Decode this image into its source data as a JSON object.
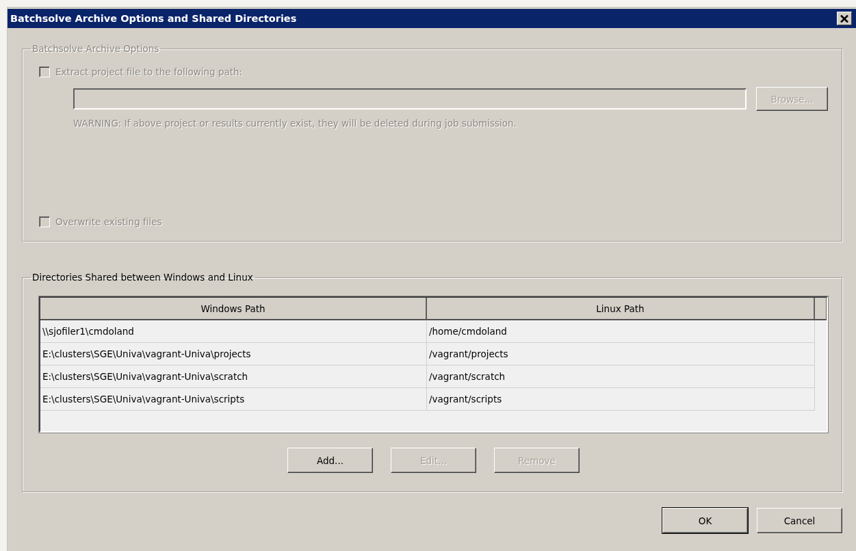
{
  "window": {
    "title": "Batchsolve Archive Options and Shared Directories"
  },
  "archive_options": {
    "legend": "Batchsolve Archive Options",
    "disabled": true,
    "extract": {
      "label": "Extract project file to the following path:",
      "checked": false
    },
    "browse": "Browse...",
    "warning": "WARNING: If above project or results currently exist, they will be deleted during job submission.",
    "overwrite": {
      "label": "Overwrite existing files",
      "checked": false
    }
  },
  "shared_directories": {
    "legend": "Directories Shared between Windows and Linux",
    "table": {
      "columns": [
        "Windows Path",
        "Linux Path"
      ],
      "rows": [
        [
          "\\\\sjofiler1\\cmdoland",
          "/home/cmdoland"
        ],
        [
          "E:\\clusters\\SGE\\Univa\\vagrant-Univa\\projects",
          "/vagrant/projects"
        ],
        [
          "E:\\clusters\\SGE\\Univa\\vagrant-Univa\\scratch",
          "/vagrant/scratch"
        ],
        [
          "E:\\clusters\\SGE\\Univa\\vagrant-Univa\\scripts",
          "/vagrant/scripts"
        ]
      ]
    },
    "buttons": [
      {
        "label": "Add...",
        "disabled": false
      },
      {
        "label": "Edit...",
        "disabled": true
      },
      {
        "label": "Remove",
        "disabled": true
      }
    ]
  },
  "footer_buttons": [
    {
      "label": "OK",
      "default": true
    },
    {
      "label": "Cancel",
      "default": false
    }
  ]
}
